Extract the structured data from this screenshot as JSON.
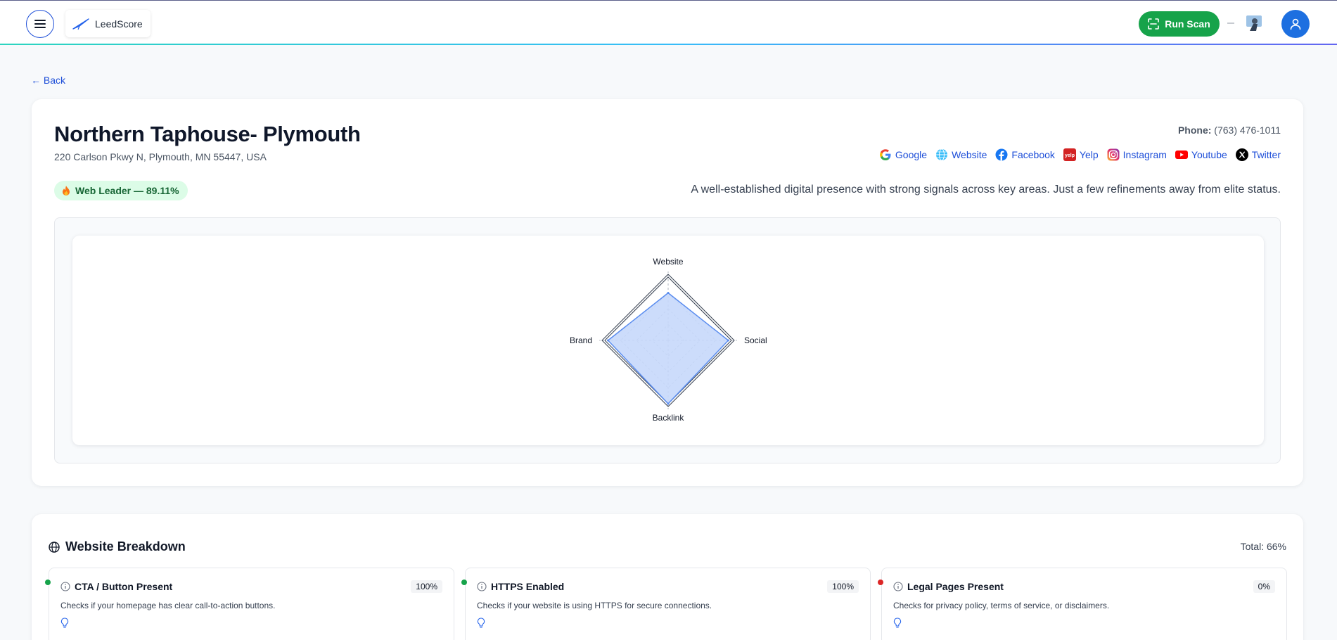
{
  "header": {
    "brand": "LeedScore",
    "run_scan_label": "Run Scan"
  },
  "nav": {
    "back_label": "← Back"
  },
  "business": {
    "name": "Northern Taphouse- Plymouth",
    "address": "220 Carlson Pkwy N, Plymouth, MN 55447, USA",
    "phone_label": "Phone:",
    "phone": "(763) 476-1011",
    "links": [
      "Google",
      "Website",
      "Facebook",
      "Yelp",
      "Instagram",
      "Youtube",
      "Twitter"
    ],
    "badge": "Web Leader — 89.11%",
    "summary": "A well-established digital presence with strong signals across key areas. Just a few refinements away from elite status."
  },
  "chart_data": {
    "type": "radar",
    "axes": [
      "Website",
      "Social",
      "Backlink",
      "Brand"
    ],
    "series": [
      {
        "values": [
          0.75,
          0.95,
          1.0,
          0.95
        ]
      }
    ],
    "range": [
      0,
      1
    ],
    "grid": true,
    "colors": {
      "fill": "#c7d8fb",
      "stroke": "#5b8def"
    }
  },
  "breakdown": {
    "title": "Website Breakdown",
    "total": "Total: 66%",
    "checks": [
      {
        "title": "CTA / Button Present",
        "pct": "100%",
        "desc": "Checks if your homepage has clear call-to-action buttons.",
        "status_color": "#16a34a"
      },
      {
        "title": "HTTPS Enabled",
        "pct": "100%",
        "desc": "Checks if your website is using HTTPS for secure connections.",
        "status_color": "#16a34a"
      },
      {
        "title": "Legal Pages Present",
        "pct": "0%",
        "desc": "Checks for privacy policy, terms of service, or disclaimers.",
        "status_color": "#dc2626"
      }
    ]
  }
}
